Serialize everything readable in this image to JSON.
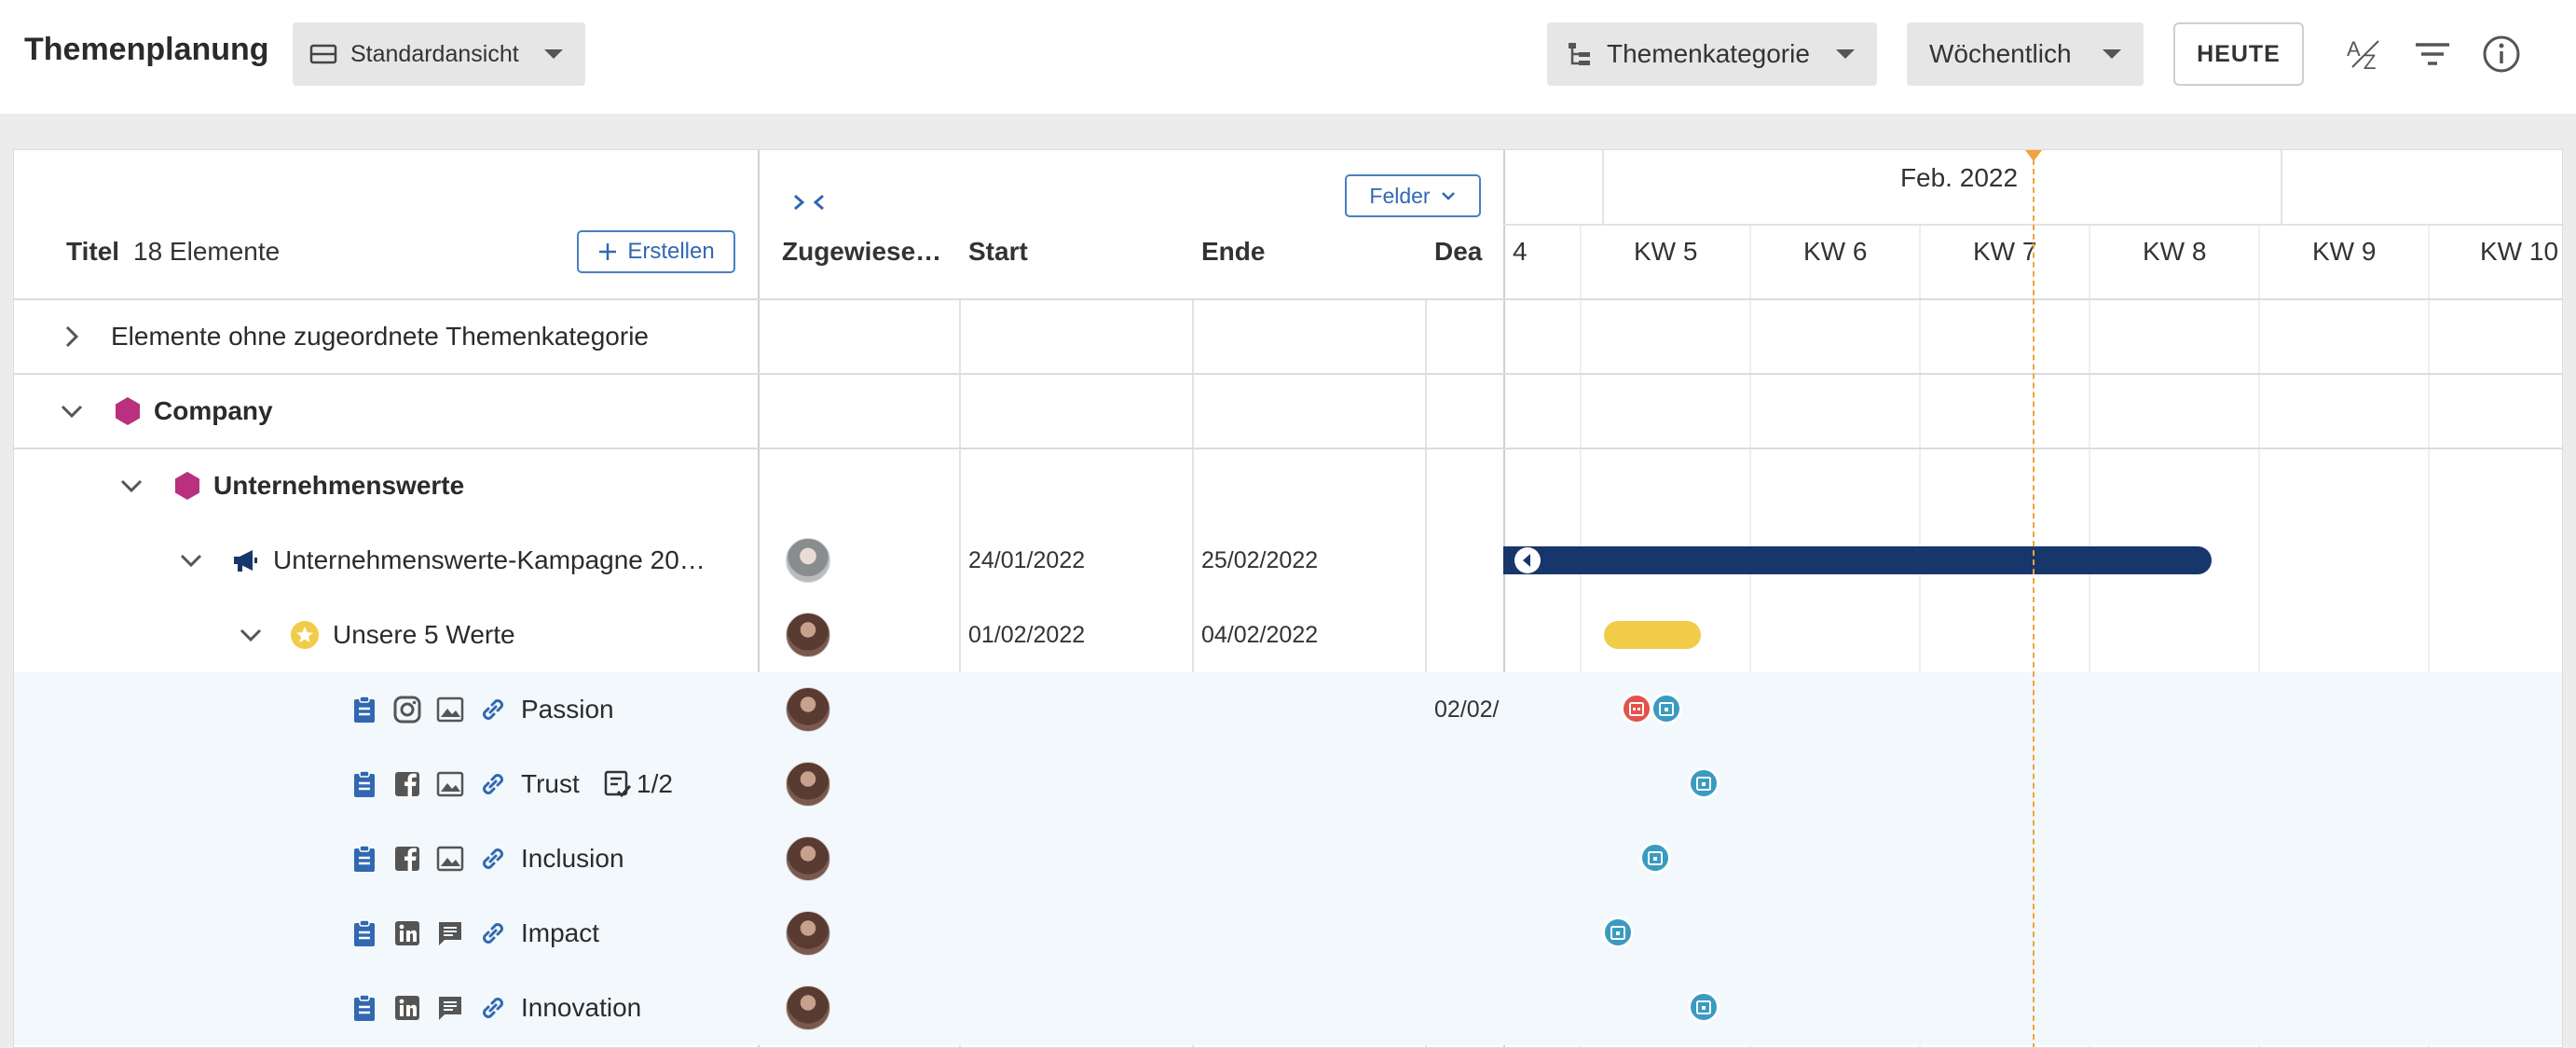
{
  "header": {
    "title": "Themenplanung",
    "view_label": "Standardansicht",
    "category_label": "Themenkategorie",
    "period_label": "Wöchentlich",
    "today_label": "HEUTE"
  },
  "list": {
    "title_label": "Titel",
    "count_label": "18 Elemente",
    "create_label": "Erstellen",
    "fields_label": "Felder",
    "columns": {
      "assigned": "Zugewiese…",
      "start": "Start",
      "end": "Ende",
      "deadline": "Dea"
    }
  },
  "timeline": {
    "month": "Feb. 2022",
    "weeks": [
      "4",
      "KW 5",
      "KW 6",
      "KW 7",
      "KW 8",
      "KW 9",
      "KW 10"
    ]
  },
  "rows": [
    {
      "label": "Elemente ohne zugeordnete Themenkategorie"
    },
    {
      "label": "Company",
      "color": "#b8307e"
    },
    {
      "label": "Unternehmenswerte",
      "color": "#b8307e"
    },
    {
      "label": "Unternehmenswerte-Kampagne 20…",
      "start": "24/01/2022",
      "end": "25/02/2022",
      "bar_color": "#17366b"
    },
    {
      "label": "Unsere 5 Werte",
      "start": "01/02/2022",
      "end": "04/02/2022",
      "bar_color": "#f1cc4a"
    },
    {
      "label": "Passion",
      "deadline": "02/02/",
      "network": "instagram"
    },
    {
      "label": "Trust",
      "tasks": "1/2",
      "network": "facebook"
    },
    {
      "label": "Inclusion",
      "network": "facebook"
    },
    {
      "label": "Impact",
      "network": "linkedin"
    },
    {
      "label": "Innovation",
      "network": "linkedin"
    }
  ],
  "colors": {
    "accent_blue": "#3168b1",
    "dot_teal": "#3a9bc1",
    "dot_red": "#e5514b",
    "today_line": "#f1a33c"
  }
}
